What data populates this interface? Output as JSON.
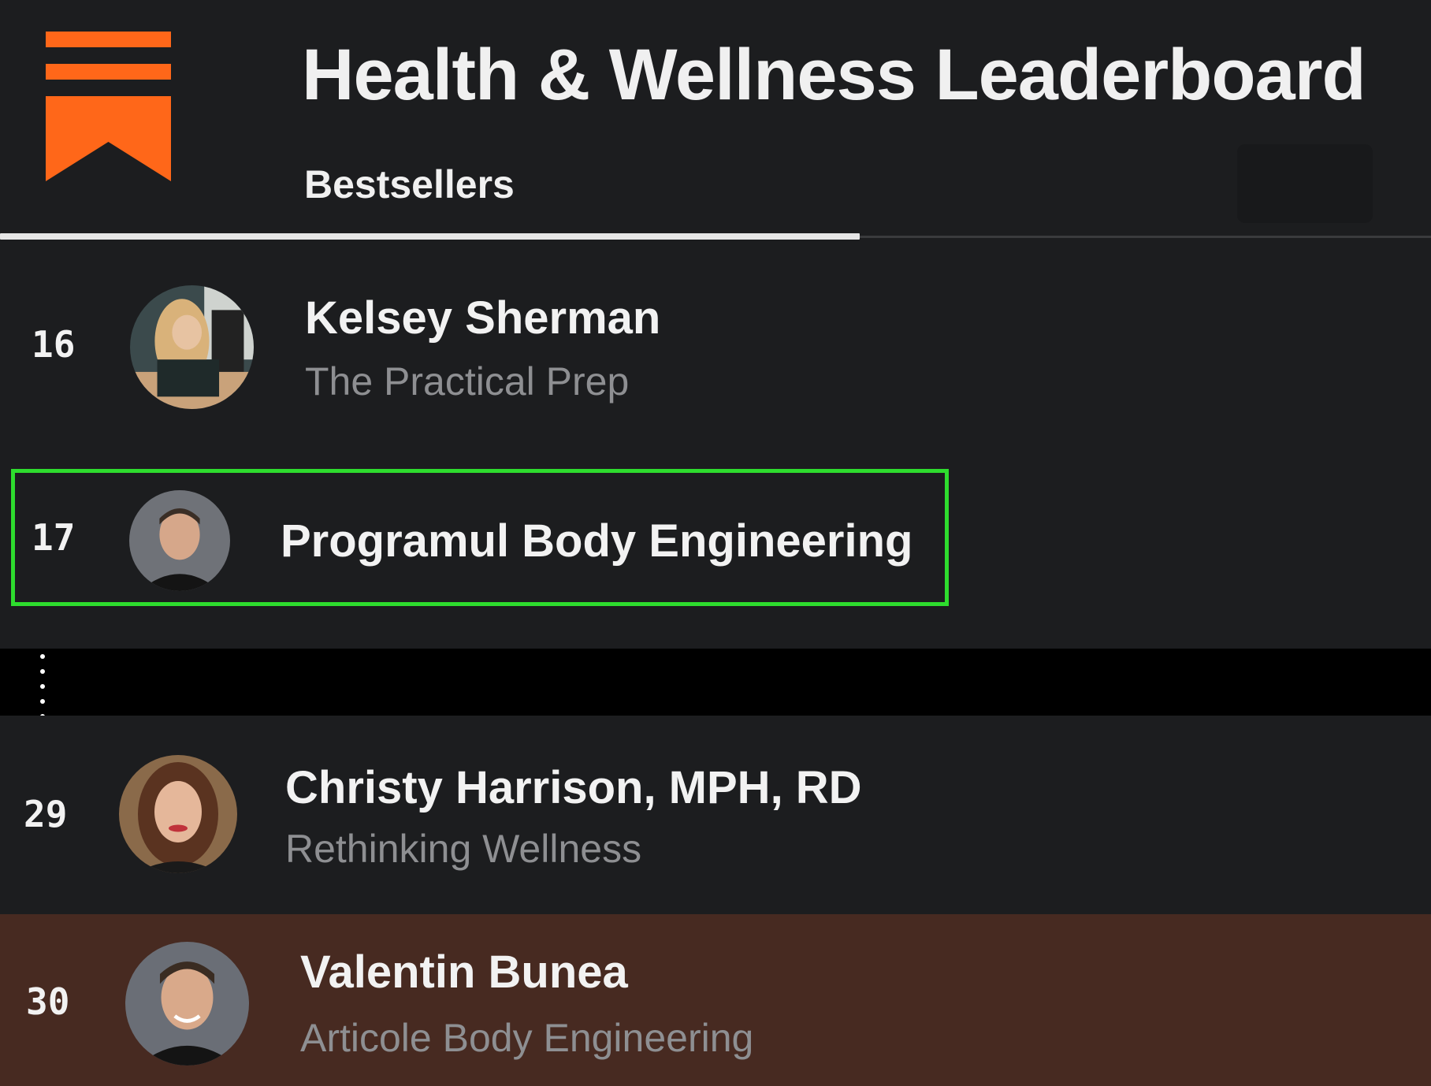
{
  "header": {
    "title": "Health & Wellness Leaderboard",
    "tab_label": "Bestsellers",
    "logo_icon": "substack-bookmark-icon",
    "brand_color": "#ff6719"
  },
  "rows": [
    {
      "rank": "16",
      "name": "Kelsey Sherman",
      "publication": "The Practical Prep",
      "avatar_icon": "avatar-photo"
    },
    {
      "rank": "17",
      "name": "Programul Body Engineering",
      "highlighted": true,
      "highlight_color": "#2edd2e",
      "avatar_icon": "avatar-photo"
    },
    {
      "rank": "29",
      "name": "Christy Harrison, MPH, RD",
      "publication": "Rethinking Wellness",
      "avatar_icon": "avatar-photo"
    },
    {
      "rank": "30",
      "name": "Valentin Bunea",
      "publication": "Articole Body Engineering",
      "row_color": "#472a21",
      "avatar_icon": "avatar-photo"
    }
  ],
  "separator_icon": "vertical-ellipsis-icon"
}
